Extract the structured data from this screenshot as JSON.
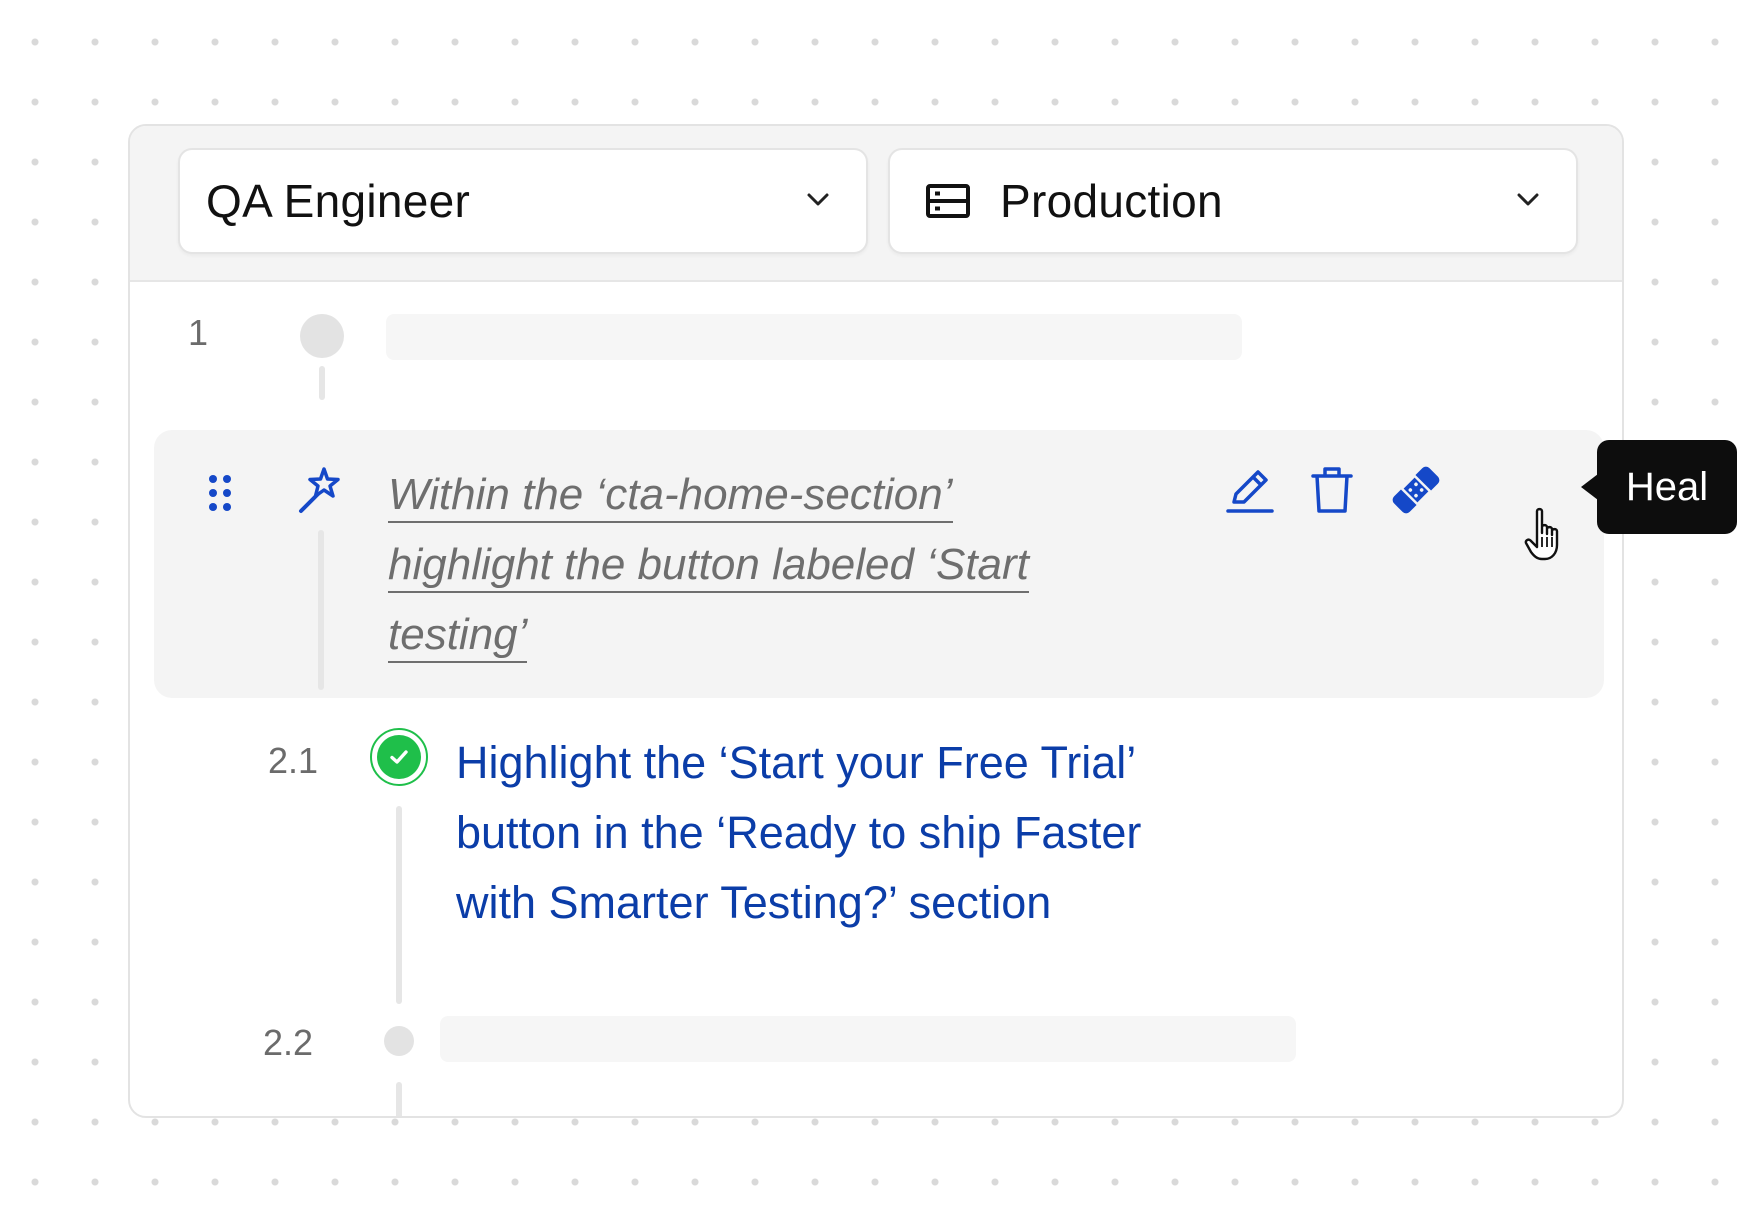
{
  "header": {
    "role_select": {
      "value": "QA Engineer",
      "icon": "chevron-down-icon"
    },
    "env_select": {
      "value": "Production",
      "icon": "server-icon"
    }
  },
  "steps": [
    {
      "number": "1",
      "state": "placeholder"
    },
    {
      "state": "active",
      "icon": "magic-wand-icon",
      "text_lines": [
        "Within the ‘cta-home-section’",
        "highlight the button labeled ‘Start",
        "testing’"
      ],
      "actions": [
        {
          "name": "edit",
          "icon": "pencil-icon"
        },
        {
          "name": "delete",
          "icon": "trash-icon"
        },
        {
          "name": "heal",
          "icon": "bandage-icon"
        }
      ]
    },
    {
      "number": "2.1",
      "status": "passed",
      "text_lines": [
        "Highlight the ‘Start your Free Trial’",
        "button in the ‘Ready to ship Faster",
        "with Smarter Testing?’ section"
      ]
    },
    {
      "number": "2.2",
      "state": "placeholder"
    }
  ],
  "tooltip": {
    "label": "Heal"
  },
  "colors": {
    "accent": "#0b3da8",
    "icon_blue": "#1548c8",
    "success": "#1fbf4a",
    "tooltip_bg": "#0d0d0d"
  }
}
